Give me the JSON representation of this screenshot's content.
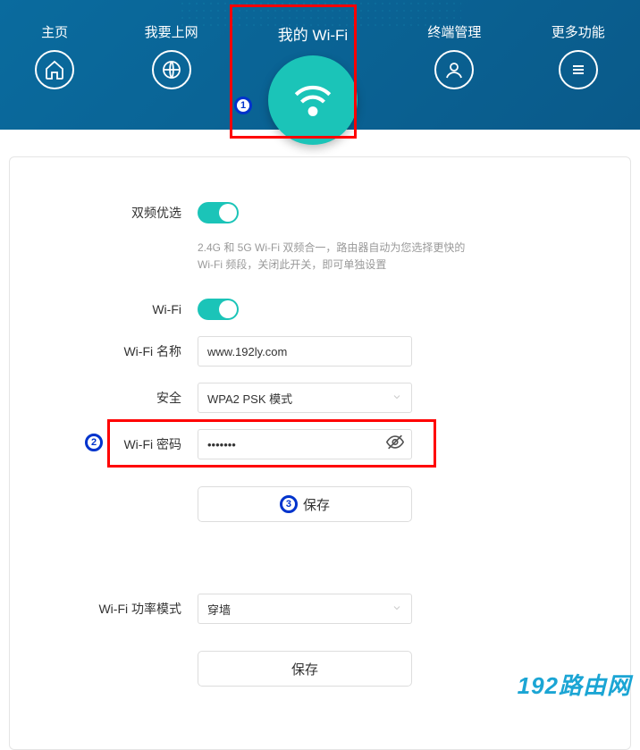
{
  "nav": {
    "home": "主页",
    "internet": "我要上网",
    "wifi": "我的 Wi-Fi",
    "devices": "终端管理",
    "more": "更多功能"
  },
  "badges": {
    "b1": "1",
    "b2": "2",
    "b3": "3"
  },
  "form": {
    "dualBandLabel": "双频优选",
    "dualBandHint": "2.4G 和 5G Wi-Fi 双频合一，路由器自动为您选择更快的 Wi-Fi 频段，关闭此开关，即可单独设置",
    "wifiToggleLabel": "Wi-Fi",
    "nameLabel": "Wi-Fi 名称",
    "nameValue": "www.192ly.com",
    "securityLabel": "安全",
    "securityValue": "WPA2 PSK 模式",
    "passwordLabel": "Wi-Fi 密码",
    "passwordValue": "•••••••",
    "saveLabel": "保存",
    "powerModeLabel": "Wi-Fi 功率模式",
    "powerModeValue": "穿墙",
    "save2Label": "保存"
  },
  "watermark": "192路由网"
}
